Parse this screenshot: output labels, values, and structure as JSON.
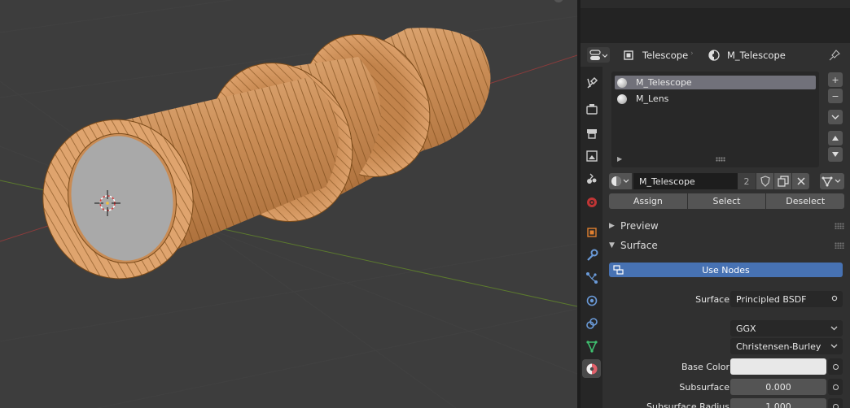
{
  "header": {
    "object_name": "Telescope",
    "material_name": "M_Telescope",
    "icons": [
      "editor-type-icon",
      "object-icon",
      "material-icon",
      "pin-icon"
    ]
  },
  "tabs": [
    {
      "name": "tool-tab-icon",
      "active": false
    },
    {
      "name": "render-tab-icon",
      "active": false
    },
    {
      "name": "output-tab-icon",
      "active": false
    },
    {
      "name": "view-layer-tab-icon",
      "active": false
    },
    {
      "name": "scene-tab-icon",
      "active": false
    },
    {
      "name": "world-tab-icon",
      "active": false
    },
    {
      "name": "object-tab-icon",
      "active": false
    },
    {
      "name": "modifier-tab-icon",
      "active": false
    },
    {
      "name": "particles-tab-icon",
      "active": false
    },
    {
      "name": "physics-tab-icon",
      "active": false
    },
    {
      "name": "constraints-tab-icon",
      "active": false
    },
    {
      "name": "data-tab-icon",
      "active": false
    },
    {
      "name": "material-tab-icon",
      "active": true
    }
  ],
  "slots": [
    {
      "label": "M_Telescope",
      "selected": true
    },
    {
      "label": "M_Lens",
      "selected": false
    }
  ],
  "slot_buttons": {
    "add": "+",
    "remove": "−"
  },
  "material_selector": {
    "name": "M_Telescope",
    "users": "2"
  },
  "edit_buttons": {
    "assign": "Assign",
    "select": "Select",
    "deselect": "Deselect"
  },
  "sections": {
    "preview": "Preview",
    "surface": "Surface"
  },
  "use_nodes": "Use Nodes",
  "properties": {
    "surface_label": "Surface",
    "surface_value": "Principled BSDF",
    "distribution": "GGX",
    "subsurface_method": "Christensen-Burley",
    "base_color_label": "Base Color",
    "base_color": "#e8e8e8",
    "subsurface_label": "Subsurface",
    "subsurface_value": "0.000",
    "subsurface_radius_label": "Subsurface Radius",
    "subsurface_radius_value": "1.000"
  },
  "colors": {
    "accent": "#4772b3",
    "mesh_body": "#c88a52",
    "wire": "#7a4a18",
    "lens": "#a9a9a9"
  }
}
